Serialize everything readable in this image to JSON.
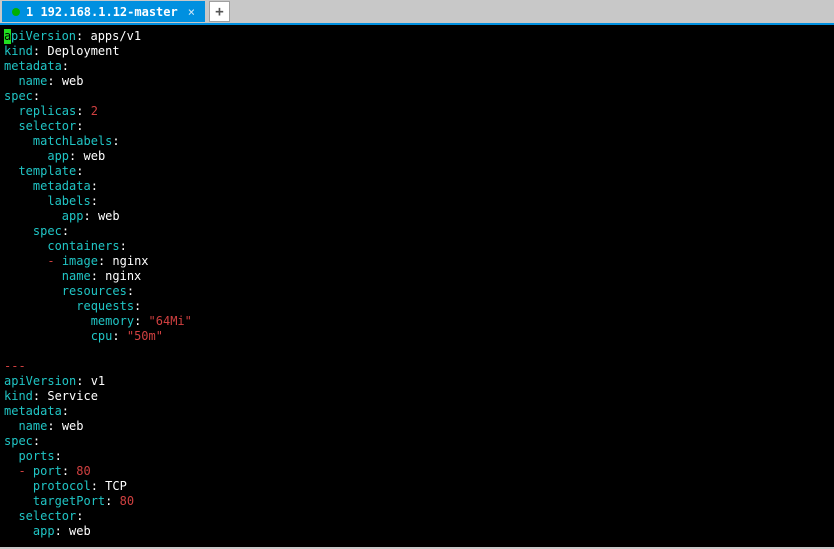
{
  "tab": {
    "label": "1 192.168.1.12-master",
    "close_glyph": "×"
  },
  "add_tab_glyph": "+",
  "yaml": {
    "cursor_char": "a",
    "l1_rest": "piVersion",
    "l1_val": "apps/v1",
    "l2_key": "kind",
    "l2_val": "Deployment",
    "l3_key": "metadata",
    "l4_key": "name",
    "l4_val": "web",
    "l5_key": "spec",
    "l6_key": "replicas",
    "l6_val": "2",
    "l7_key": "selector",
    "l8_key": "matchLabels",
    "l9_key": "app",
    "l9_val": "web",
    "l10_key": "template",
    "l11_key": "metadata",
    "l12_key": "labels",
    "l13_key": "app",
    "l13_val": "web",
    "l14_key": "spec",
    "l15_key": "containers",
    "l16_dash": "-",
    "l16_key": "image",
    "l16_val": "nginx",
    "l17_key": "name",
    "l17_val": "nginx",
    "l18_key": "resources",
    "l19_key": "requests",
    "l20_key": "memory",
    "l20_val": "\"64Mi\"",
    "l21_key": "cpu",
    "l21_val": "\"50m\"",
    "sep": "---",
    "s1_key": "apiVersion",
    "s1_val": "v1",
    "s2_key": "kind",
    "s2_val": "Service",
    "s3_key": "metadata",
    "s4_key": "name",
    "s4_val": "web",
    "s5_key": "spec",
    "s6_key": "ports",
    "s7_dash": "-",
    "s7_key": "port",
    "s7_val": "80",
    "s8_key": "protocol",
    "s8_val": "TCP",
    "s9_key": "targetPort",
    "s9_val": "80",
    "s10_key": "selector",
    "s11_key": "app",
    "s11_val": "web"
  }
}
